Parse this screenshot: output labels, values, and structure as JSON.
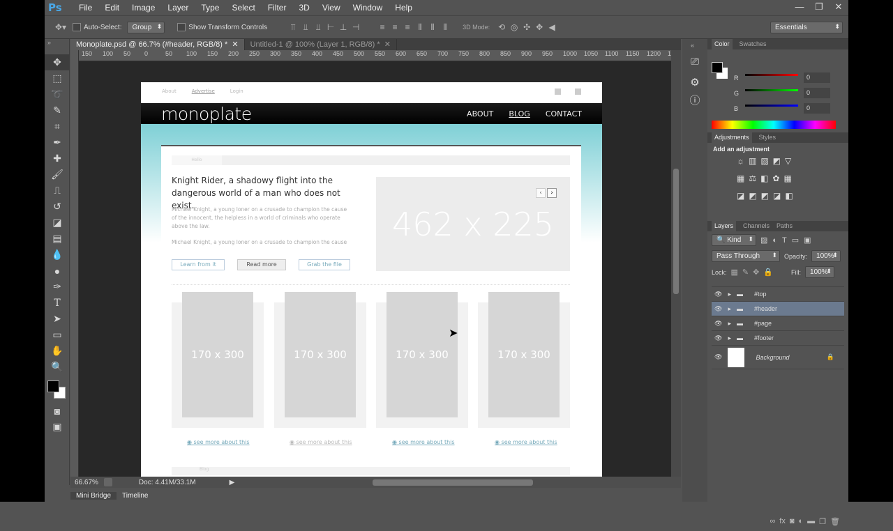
{
  "menu": {
    "logo": "Ps",
    "items": [
      "File",
      "Edit",
      "Image",
      "Layer",
      "Type",
      "Select",
      "Filter",
      "3D",
      "View",
      "Window",
      "Help"
    ]
  },
  "options": {
    "auto_select": "Auto-Select:",
    "group": "Group",
    "show_transform": "Show Transform Controls",
    "mode3d": "3D Mode:",
    "workspace": "Essentials"
  },
  "tabs": [
    "Monoplate.psd @ 66.7% (#header, RGB/8) *",
    "Untitled-1 @ 100% (Layer 1, RGB/8) *"
  ],
  "ruler": [
    "150",
    "100",
    "50",
    "0",
    "50",
    "100",
    "150",
    "200",
    "250",
    "300",
    "350",
    "400",
    "450",
    "500",
    "550",
    "600",
    "650",
    "700",
    "750",
    "800",
    "850",
    "900",
    "950",
    "1000",
    "1050",
    "1100",
    "1150",
    "1200",
    "1"
  ],
  "status": {
    "zoom": "66.67%",
    "doc": "Doc: 4.41M/33.1M"
  },
  "bottom_tabs": [
    "Mini Bridge",
    "Timeline"
  ],
  "color_panel": {
    "tabs": [
      "Color",
      "Swatches"
    ],
    "r": "0",
    "g": "0",
    "b": "0",
    "labels": [
      "R",
      "G",
      "B"
    ]
  },
  "adjustments": {
    "tabs": [
      "Adjustments",
      "Styles"
    ],
    "title": "Add an adjustment"
  },
  "layers_panel": {
    "tabs": [
      "Layers",
      "Channels",
      "Paths"
    ],
    "kind": "Kind",
    "blend": "Pass Through",
    "opacity_label": "Opacity:",
    "opacity": "100%",
    "lock_label": "Lock:",
    "fill_label": "Fill:",
    "fill": "100%",
    "layers": [
      "#top",
      "#header",
      "#page",
      "#footer"
    ],
    "background": "Background"
  },
  "site": {
    "top_links": [
      "About",
      "Advertise",
      "Login"
    ],
    "logo": "monoplate",
    "nav": [
      "ABOUT",
      "BLOG",
      "CONTACT"
    ],
    "tab_label": "Hello",
    "headline": "Knight Rider, a shadowy flight into the dangerous world of a man who does not exist.",
    "para1": "Michael Knight, a young loner on a crusade to champion the cause of the innocent, the helpless in a world of criminals who operate above the law.",
    "para2": "Michael Knight, a young loner on a crusade to champion the cause",
    "buttons": [
      "Learn from it",
      "Read more",
      "Grab the file"
    ],
    "slider": "462 x 225",
    "thumb": "170 x 300",
    "see_more": "see more about this",
    "blog": "Blog"
  }
}
